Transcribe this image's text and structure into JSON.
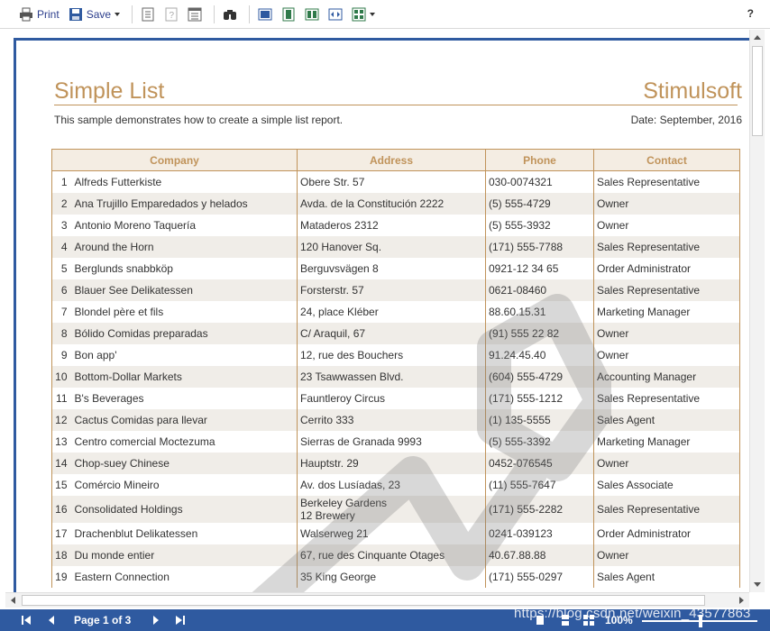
{
  "toolbar": {
    "print_label": "Print",
    "save_label": "Save",
    "help_label": "?"
  },
  "report": {
    "title": "Simple List",
    "brand": "Stimulsoft",
    "subtitle": "This sample demonstrates how to create a simple list report.",
    "date": "Date: September, 2016",
    "columns": [
      "Company",
      "Address",
      "Phone",
      "Contact"
    ],
    "rows": [
      {
        "n": "1",
        "company": "Alfreds Futterkiste",
        "address": "Obere Str. 57",
        "phone": "030-0074321",
        "contact": "Sales Representative"
      },
      {
        "n": "2",
        "company": "Ana Trujillo Emparedados y helados",
        "address": "Avda. de la Constitución 2222",
        "phone": "(5) 555-4729",
        "contact": "Owner"
      },
      {
        "n": "3",
        "company": "Antonio Moreno Taquería",
        "address": "Mataderos  2312",
        "phone": "(5) 555-3932",
        "contact": "Owner"
      },
      {
        "n": "4",
        "company": "Around the Horn",
        "address": "120 Hanover Sq.",
        "phone": "(171) 555-7788",
        "contact": "Sales Representative"
      },
      {
        "n": "5",
        "company": "Berglunds snabbköp",
        "address": "Berguvsvägen  8",
        "phone": "0921-12 34 65",
        "contact": "Order Administrator"
      },
      {
        "n": "6",
        "company": "Blauer See Delikatessen",
        "address": "Forsterstr. 57",
        "phone": "0621-08460",
        "contact": "Sales Representative"
      },
      {
        "n": "7",
        "company": "Blondel père et fils",
        "address": "24, place Kléber",
        "phone": "88.60.15.31",
        "contact": "Marketing Manager"
      },
      {
        "n": "8",
        "company": "Bólido Comidas preparadas",
        "address": "C/ Araquil, 67",
        "phone": "(91) 555 22 82",
        "contact": "Owner"
      },
      {
        "n": "9",
        "company": "Bon app'",
        "address": "12, rue des Bouchers",
        "phone": "91.24.45.40",
        "contact": "Owner"
      },
      {
        "n": "10",
        "company": "Bottom-Dollar Markets",
        "address": "23 Tsawwassen Blvd.",
        "phone": "(604) 555-4729",
        "contact": "Accounting Manager"
      },
      {
        "n": "11",
        "company": "B's Beverages",
        "address": "Fauntleroy Circus",
        "phone": "(171) 555-1212",
        "contact": "Sales Representative"
      },
      {
        "n": "12",
        "company": "Cactus Comidas para llevar",
        "address": "Cerrito 333",
        "phone": "(1) 135-5555",
        "contact": "Sales Agent"
      },
      {
        "n": "13",
        "company": "Centro comercial Moctezuma",
        "address": "Sierras de Granada 9993",
        "phone": "(5) 555-3392",
        "contact": "Marketing Manager"
      },
      {
        "n": "14",
        "company": "Chop-suey Chinese",
        "address": "Hauptstr. 29",
        "phone": "0452-076545",
        "contact": "Owner"
      },
      {
        "n": "15",
        "company": "Comércio Mineiro",
        "address": "Av. dos Lusíadas, 23",
        "phone": "(11) 555-7647",
        "contact": "Sales Associate"
      },
      {
        "n": "16",
        "company": "Consolidated Holdings",
        "address_line1": "Berkeley Gardens",
        "address_line2": "12  Brewery",
        "phone": "(171) 555-2282",
        "contact": "Sales Representative"
      },
      {
        "n": "17",
        "company": "Drachenblut Delikatessen",
        "address": "Walserweg 21",
        "phone": "0241-039123",
        "contact": "Order Administrator"
      },
      {
        "n": "18",
        "company": "Du monde entier",
        "address": "67, rue des Cinquante Otages",
        "phone": "40.67.88.88",
        "contact": "Owner"
      },
      {
        "n": "19",
        "company": "Eastern Connection",
        "address": "35 King George",
        "phone": "(171) 555-0297",
        "contact": "Sales Agent"
      }
    ]
  },
  "statusbar": {
    "page_label": "Page 1 of 3",
    "zoom": "100%",
    "overlay_text": "https://blog.csdn.net/weixin_43577863"
  },
  "colors": {
    "accent": "#c0935a",
    "header_bg": "#f4ede3",
    "status_bar": "#2f5aa0",
    "alt_row": "#f0ede8"
  }
}
